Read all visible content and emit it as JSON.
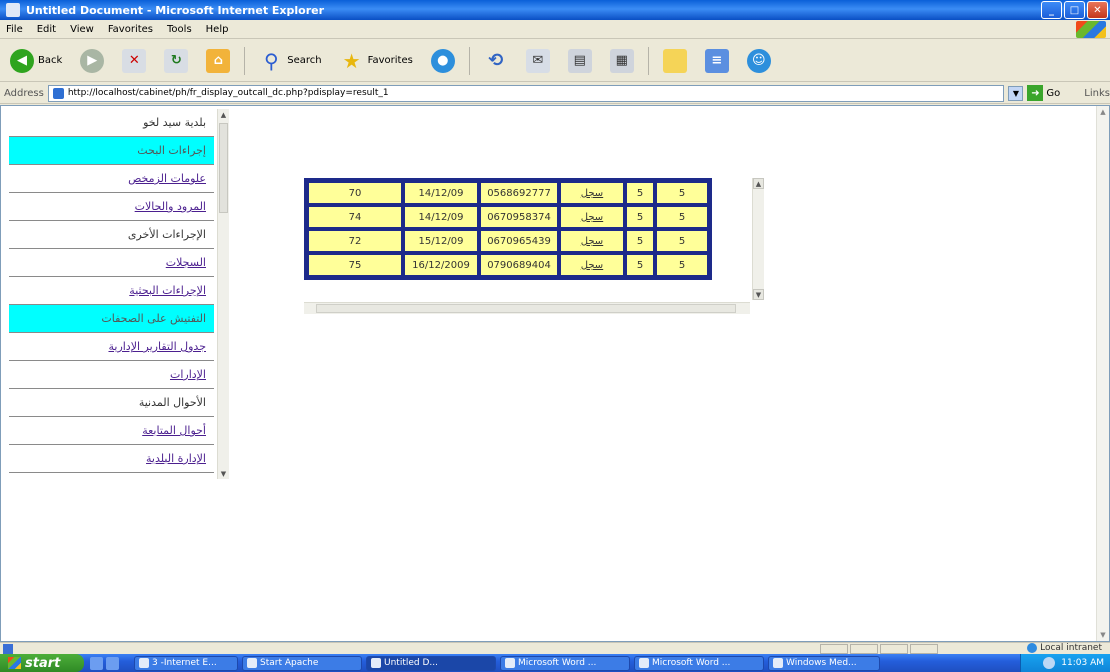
{
  "window": {
    "title": "Untitled Document - Microsoft Internet Explorer",
    "buttons": {
      "minimize": "_",
      "maximize": "□",
      "close": "✕"
    }
  },
  "menubar": [
    "File",
    "Edit",
    "View",
    "Favorites",
    "Tools",
    "Help"
  ],
  "toolbar": {
    "back": "Back",
    "search": "Search",
    "favorites": "Favorites",
    "icons": [
      "back-icon",
      "forward-icon",
      "stop-icon",
      "refresh-icon",
      "home-icon",
      "search-icon",
      "favorites-icon",
      "media-icon",
      "history-icon",
      "mail-icon",
      "print-icon",
      "edit-icon",
      "folder-icon",
      "messenger-icon"
    ]
  },
  "address": {
    "label": "Address",
    "url": "http://localhost/cabinet/ph/fr_display_outcall_dc.php?pdisplay=result_1",
    "go": "Go",
    "links": "Links"
  },
  "sidebar": {
    "items": [
      {
        "label": "بلدية سيد لخو",
        "style": "plain"
      },
      {
        "label": "إجراءات البحث",
        "style": "highlight"
      },
      {
        "label": "علومات الزمخص",
        "style": "link"
      },
      {
        "label": "المرود والحالات",
        "style": "link"
      },
      {
        "label": "الإجراءات الأخرى",
        "style": "plain"
      },
      {
        "label": "السجلات",
        "style": "link"
      },
      {
        "label": "الإجراءات البحثية",
        "style": "link"
      },
      {
        "label": "التفتيش على الصحفات",
        "style": "highlight"
      },
      {
        "label": "جدول التقارير الإدارية",
        "style": "link"
      },
      {
        "label": "الإدارات",
        "style": "link"
      },
      {
        "label": "الأحوال المدنية",
        "style": "plain"
      },
      {
        "label": "أحوال المتابعة",
        "style": "link"
      },
      {
        "label": "الإدارة البلدية",
        "style": "link"
      }
    ]
  },
  "table": {
    "rows": [
      {
        "no": "70",
        "date": "14/12/09",
        "phone": "0568692777",
        "link": "سجل",
        "a": "5",
        "b": "5"
      },
      {
        "no": "74",
        "date": "14/12/09",
        "phone": "0670958374",
        "link": "سجل",
        "a": "5",
        "b": "5"
      },
      {
        "no": "72",
        "date": "15/12/09",
        "phone": "0670965439",
        "link": "سجل",
        "a": "5",
        "b": "5"
      },
      {
        "no": "75",
        "date": "16/12/2009",
        "phone": "0790689404",
        "link": "سجل",
        "a": "5",
        "b": "5"
      }
    ]
  },
  "status": {
    "zone": "Local intranet"
  },
  "taskbar": {
    "start": "start",
    "tasks": [
      {
        "label": "3 -Internet E..."
      },
      {
        "label": "Start Apache"
      },
      {
        "label": "Untitled D..."
      },
      {
        "label": "Microsoft Word ..."
      },
      {
        "label": "Microsoft Word ..."
      },
      {
        "label": "Windows Med..."
      }
    ],
    "clock": "11:03 AM"
  }
}
